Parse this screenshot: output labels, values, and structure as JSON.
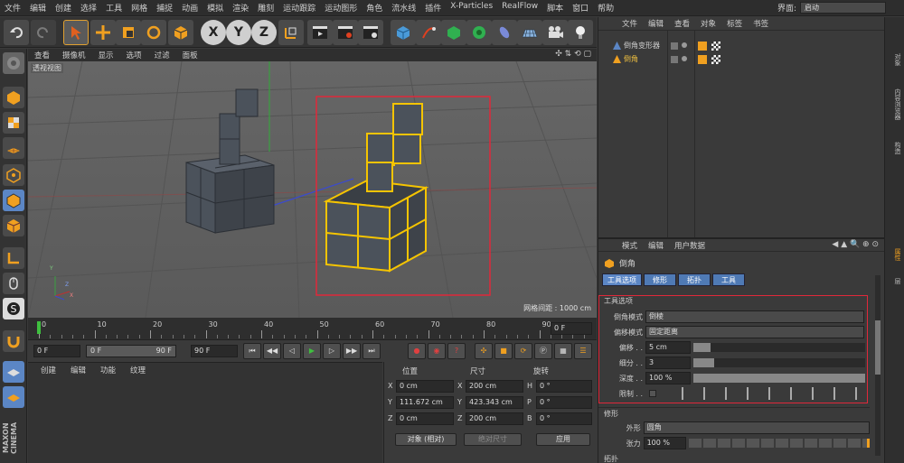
{
  "menu": [
    "文件",
    "编辑",
    "创建",
    "选择",
    "工具",
    "网格",
    "捕捉",
    "动画",
    "模拟",
    "渲染",
    "雕刻",
    "运动跟踪",
    "运动图形",
    "角色",
    "流水线",
    "插件",
    "X-Particles",
    "RealFlow",
    "脚本",
    "窗口",
    "帮助"
  ],
  "interface": {
    "label": "界面:",
    "value": "启动"
  },
  "toolbar": {
    "axis_x": "X",
    "axis_y": "Y",
    "axis_z": "Z"
  },
  "viewport": {
    "menu": [
      "查看",
      "摄像机",
      "显示",
      "选项",
      "过滤",
      "面板"
    ],
    "view_label": "透视视图",
    "grid_spacing": "网格间距 : 1000 cm",
    "axis_y": "Y",
    "axis_z": "Z",
    "axis_x": "X"
  },
  "timeline": {
    "ticks": [
      "0",
      "10",
      "20",
      "30",
      "40",
      "50",
      "60",
      "70",
      "80",
      "90"
    ],
    "current_frame": "0 F"
  },
  "transport": {
    "start": "0 F",
    "range_start": "0 F",
    "range_end": "90 F",
    "end": "90 F"
  },
  "material_panel": {
    "menu": [
      "创建",
      "编辑",
      "功能",
      "纹理"
    ]
  },
  "coords": {
    "headers": [
      "位置",
      "尺寸",
      "旋转"
    ],
    "rows": [
      {
        "axis": "X",
        "pos": "0 cm",
        "size_axis": "X",
        "size": "200 cm",
        "rot_axis": "H",
        "rot": "0 °"
      },
      {
        "axis": "Y",
        "pos": "111.672 cm",
        "size_axis": "Y",
        "size": "423.343 cm",
        "rot_axis": "P",
        "rot": "0 °"
      },
      {
        "axis": "Z",
        "pos": "0 cm",
        "size_axis": "Z",
        "size": "200 cm",
        "rot_axis": "B",
        "rot": "0 °"
      }
    ],
    "mode": "对象 (相对)",
    "size_mode": "绝对尺寸",
    "apply": "应用"
  },
  "object_manager": {
    "menu": [
      "文件",
      "编辑",
      "查看",
      "对象",
      "标签",
      "书签"
    ],
    "objects": [
      {
        "name": "倒角变形器",
        "color": "#cfcfcf"
      },
      {
        "name": "倒角",
        "color": "#f0c040"
      }
    ]
  },
  "attributes": {
    "menu": [
      "模式",
      "编辑",
      "用户数据"
    ],
    "object_name": "倒角",
    "tabs": [
      "工具选项",
      "修形",
      "拓扑",
      "工具"
    ],
    "section_tool": "工具选项",
    "fields": [
      {
        "label": "倒角模式",
        "value": "倒棱"
      },
      {
        "label": "偏移模式",
        "value": "固定距离"
      },
      {
        "label": "偏移 . .",
        "value": "5 cm"
      },
      {
        "label": "细分 . .",
        "value": "3"
      },
      {
        "label": "深度 . .",
        "value": "100 %"
      },
      {
        "label": "限制 . .",
        "value": ""
      }
    ],
    "section_shape": "修形",
    "shape_label": "外形",
    "shape_value": "圆角",
    "tension_label": "张力",
    "tension_value": "100 %",
    "section_topology": "拓扑"
  },
  "right_tabs": [
    "对象",
    "内容浏览器",
    "构造",
    "属性",
    "层"
  ],
  "brand": [
    "MAXON",
    "CINEMA"
  ],
  "colors": {
    "selection": "#f5c400",
    "highlight_box": "#e0283a",
    "accent_blue": "#5b86c5"
  }
}
